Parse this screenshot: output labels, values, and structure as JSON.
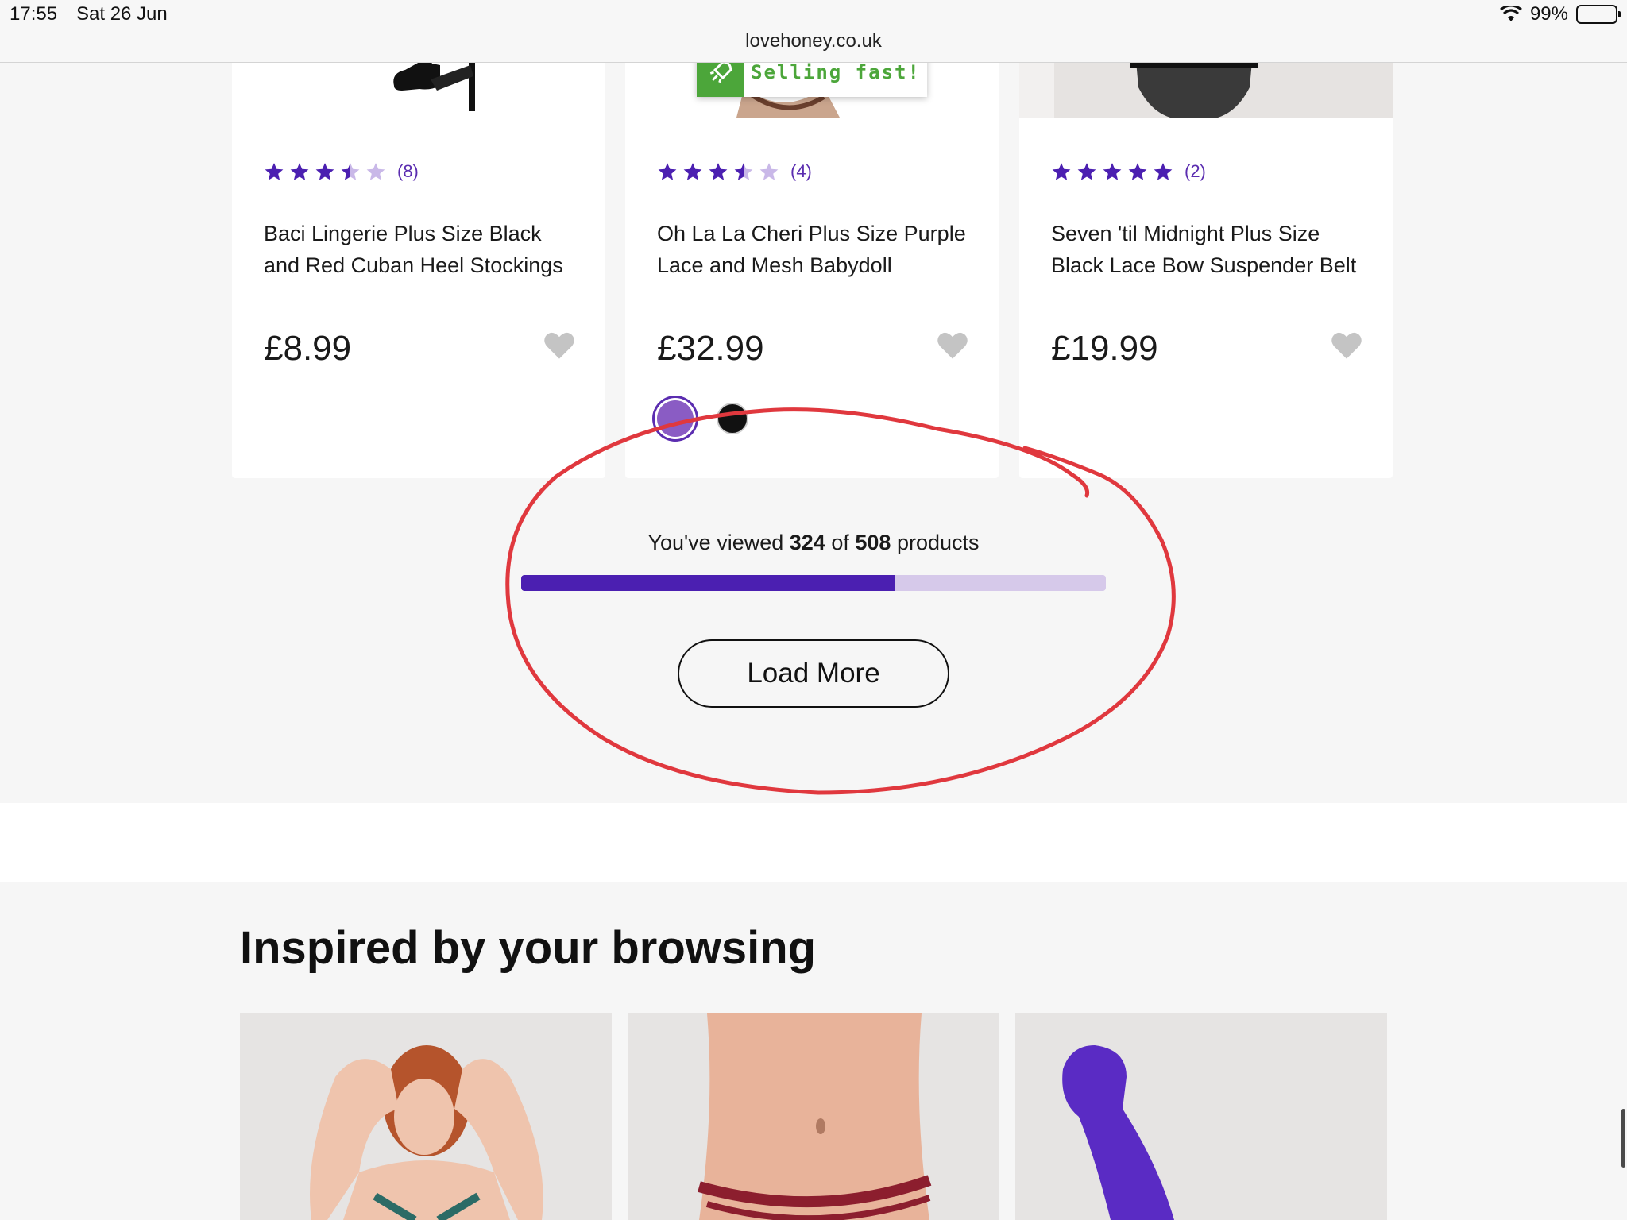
{
  "status": {
    "time": "17:55",
    "date": "Sat 26 Jun",
    "battery": "99%",
    "icons": [
      "wifi-icon",
      "battery-icon"
    ]
  },
  "browser": {
    "url": "lovehoney.co.uk"
  },
  "products": [
    {
      "name": "Baci Lingerie Plus Size Black and Red Cuban Heel Stockings",
      "rating": 3.5,
      "reviews": "(8)",
      "price": "£8.99"
    },
    {
      "name": "Oh La La Cheri Plus Size Purple Lace and Mesh Babydoll",
      "rating": 3.5,
      "reviews": "(4)",
      "price": "£32.99",
      "badge": "Selling fast!",
      "swatches": [
        "#8a5cc4",
        "#111111"
      ]
    },
    {
      "name": "Seven 'til Midnight Plus Size Black Lace Bow Suspender Belt",
      "rating": 5,
      "reviews": "(2)",
      "price": "£19.99"
    }
  ],
  "progress": {
    "prefix": "You've viewed",
    "viewed": "324",
    "of": "of",
    "total": "508",
    "suffix": "products",
    "fraction": 0.638
  },
  "load_more": "Load More",
  "inspired": {
    "title": "Inspired by your browsing"
  },
  "colors": {
    "brand_purple": "#4b1fb1",
    "star": "#4b1fb1",
    "star_empty": "#c9b8e8",
    "badge_green": "#4ca63a",
    "annotation_red": "#e0383e"
  }
}
